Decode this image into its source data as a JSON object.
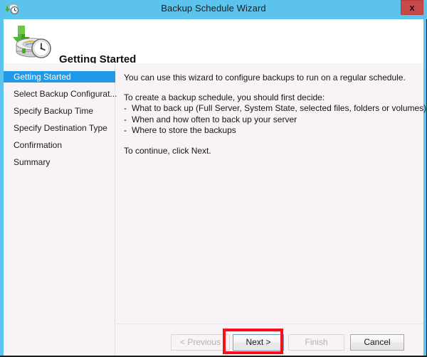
{
  "window": {
    "title": "Backup Schedule Wizard",
    "title_icon": "backup-clock-icon",
    "close_label": "x",
    "frame_color": "#5cc4ec"
  },
  "header": {
    "title": "Getting Started",
    "icon": "backup-disk-clock-icon"
  },
  "sidebar": {
    "items": [
      {
        "label": "Getting Started",
        "selected": true
      },
      {
        "label": "Select Backup Configurat...",
        "selected": false
      },
      {
        "label": "Specify Backup Time",
        "selected": false
      },
      {
        "label": "Specify Destination Type",
        "selected": false
      },
      {
        "label": "Confirmation",
        "selected": false
      },
      {
        "label": "Summary",
        "selected": false
      }
    ],
    "selected_color": "#1e9ae8"
  },
  "content": {
    "intro": "You can use this wizard to configure backups to run on a regular schedule.",
    "decide_heading": "To create a backup schedule, you should first decide:",
    "decide_items": [
      "What to back up (Full Server, System State, selected files, folders or volumes)",
      "When and how often to back up your server",
      "Where to store the backups"
    ],
    "bullet_marker": "-",
    "continue_text": "To continue, click Next."
  },
  "buttons": {
    "previous": {
      "label": "< Previous",
      "enabled": false
    },
    "next": {
      "label": "Next >",
      "enabled": true,
      "focused": true
    },
    "finish": {
      "label": "Finish",
      "enabled": false
    },
    "cancel": {
      "label": "Cancel",
      "enabled": true
    }
  },
  "annotation": {
    "target": "next-button",
    "color": "#fc0d1b"
  }
}
